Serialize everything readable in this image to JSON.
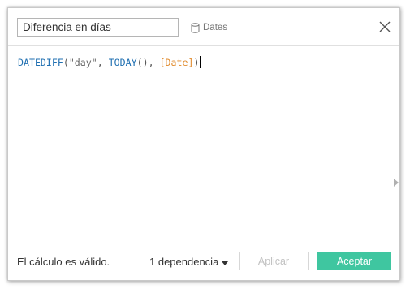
{
  "dialog": {
    "name_field": {
      "value": "Diferencia en días"
    },
    "datasource": {
      "icon": "database-icon",
      "label": "Dates"
    },
    "close_icon": "close-icon"
  },
  "formula": {
    "tokens": {
      "fn1": "DATEDIFF",
      "paren_open1": "(",
      "str": "\"day\"",
      "comma1": ", ",
      "fn2": "TODAY",
      "paren_pair": "()",
      "comma2": ", ",
      "field": "[Date]",
      "paren_close1": ")"
    }
  },
  "footer": {
    "status": "El cálculo es válido.",
    "dependencies": "1 dependencia",
    "apply_label": "Aplicar",
    "accept_label": "Aceptar"
  },
  "colors": {
    "function": "#1f6fb1",
    "field": "#e08a2b",
    "accept_button": "#3fc6a0"
  }
}
